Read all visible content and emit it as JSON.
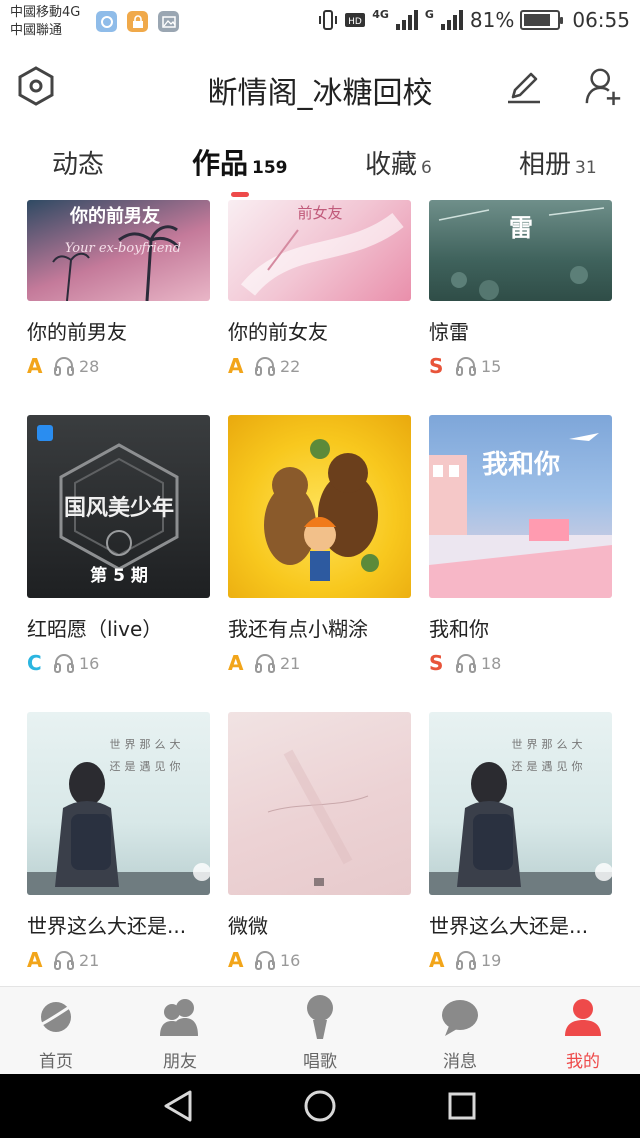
{
  "status_bar": {
    "carrier_1": "中國移動4G",
    "carrier_2": "中國聯通",
    "network_1": "4G",
    "network_2": "G",
    "battery": "81%",
    "battery_level": 0.81,
    "time": "06:55"
  },
  "header": {
    "title": "断情阁_冰糖回校",
    "settings_icon": "hexagon-settings-icon",
    "edit_icon": "pencil-icon",
    "add_friend_icon": "add-user-icon"
  },
  "tabs": [
    {
      "label": "动态",
      "count": ""
    },
    {
      "label": "作品",
      "count": "159",
      "active": true
    },
    {
      "label": "收藏",
      "count": "6"
    },
    {
      "label": "相册",
      "count": "31"
    }
  ],
  "songs": [
    {
      "title": "你的前男友",
      "grade": "A",
      "grade_color": "#f2a51a",
      "plays": "28",
      "cover_text": "你的前男友",
      "cover_sub": "Your ex-boyfriend"
    },
    {
      "title": "你的前女友",
      "grade": "A",
      "grade_color": "#f2a51a",
      "plays": "22",
      "cover_text": "前女友",
      "cover_sub": ""
    },
    {
      "title": "惊雷",
      "grade": "S",
      "grade_color": "#e8543a",
      "plays": "15",
      "cover_text": "雷",
      "cover_sub": ""
    },
    {
      "title": "红昭愿（live）",
      "grade": "C",
      "grade_color": "#2bb5e0",
      "plays": "16",
      "cover_text": "国风美少年",
      "cover_sub": "第 5 期"
    },
    {
      "title": "我还有点小糊涂",
      "grade": "A",
      "grade_color": "#f2a51a",
      "plays": "21",
      "cover_text": "",
      "cover_sub": ""
    },
    {
      "title": "我和你",
      "grade": "S",
      "grade_color": "#e8543a",
      "plays": "18",
      "cover_text": "我和你",
      "cover_sub": ""
    },
    {
      "title": "世界这么大还是...",
      "grade": "A",
      "grade_color": "#f2a51a",
      "plays": "21",
      "cover_text": "世界那么大",
      "cover_sub": "还是遇见你"
    },
    {
      "title": "微微",
      "grade": "A",
      "grade_color": "#f2a51a",
      "plays": "16",
      "cover_text": "",
      "cover_sub": ""
    },
    {
      "title": "世界这么大还是...",
      "grade": "A",
      "grade_color": "#f2a51a",
      "plays": "19",
      "cover_text": "世界那么大",
      "cover_sub": "还是遇见你"
    }
  ],
  "bottom_nav": [
    {
      "label": "首页",
      "icon": "planet-icon"
    },
    {
      "label": "朋友",
      "icon": "friends-icon"
    },
    {
      "label": "唱歌",
      "icon": "microphone-icon"
    },
    {
      "label": "消息",
      "icon": "chat-bubble-icon"
    },
    {
      "label": "我的",
      "icon": "profile-icon",
      "active": true
    }
  ],
  "colors": {
    "accent": "#ee4a4a",
    "grade_a": "#f2a51a",
    "grade_s": "#e8543a",
    "grade_c": "#2bb5e0"
  }
}
